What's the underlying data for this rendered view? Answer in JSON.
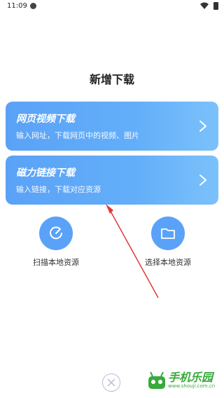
{
  "status_bar": {
    "time": "11:09"
  },
  "page_title": "新增下载",
  "cards": [
    {
      "title": "网页视频下载",
      "subtitle": "输入网址，下载网页中的视频、图片"
    },
    {
      "title": "磁力链接下载",
      "subtitle": "输入链接，下载对应资源"
    }
  ],
  "actions": [
    {
      "label": "扫描本地资源"
    },
    {
      "label": "选择本地资源"
    }
  ],
  "watermark": {
    "text": "手机乐园",
    "url": "www.shouji.com.cn"
  },
  "colors": {
    "accent": "#5aa2f7",
    "annotation_arrow": "#e03a3a"
  }
}
